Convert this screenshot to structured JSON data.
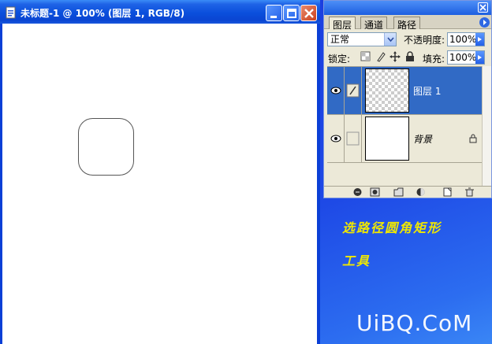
{
  "document": {
    "title": "未标题-1 @ 100% (图层 1, RGB/8)"
  },
  "layers_panel": {
    "tabs": [
      "图层",
      "通道",
      "路径"
    ],
    "blend_mode": "正常",
    "opacity_label": "不透明度:",
    "opacity_value": "100%",
    "lock_label": "锁定:",
    "fill_label": "填充:",
    "fill_value": "100%",
    "layers": [
      {
        "name": "图层 1",
        "selected": true,
        "visible": true
      },
      {
        "name": "背景",
        "selected": false,
        "visible": true,
        "locked": true
      }
    ]
  },
  "caption": {
    "line1": "选路径圆角矩形",
    "line2": "工具"
  },
  "watermark": "UiBQ.CoM",
  "colors": {
    "titlebar": "#0a4fdc",
    "selected_layer": "#316ac5",
    "panel_bg": "#ece9d8",
    "caption": "#f0e800",
    "background_blue": "#1e49e6"
  }
}
